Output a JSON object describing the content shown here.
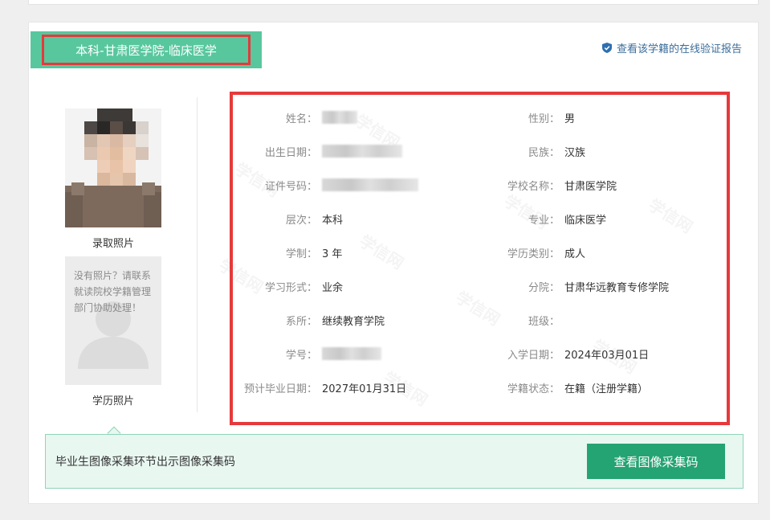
{
  "program_tag": "本科-甘肃医学院-临床医学",
  "verify_link": "查看该学籍的在线验证报告",
  "photos": {
    "admission_caption": "录取照片",
    "degree_caption": "学历照片",
    "placeholder_lines": [
      "没有照片？请联系",
      "就读院校学籍管理",
      "部门协助处理！"
    ]
  },
  "fields": {
    "name_label": "姓名：",
    "gender_label": "性别：",
    "gender_value": "男",
    "birth_label": "出生日期：",
    "ethnicity_label": "民族：",
    "ethnicity_value": "汉族",
    "id_label": "证件号码：",
    "school_label": "学校名称：",
    "school_value": "甘肃医学院",
    "level_label": "层次：",
    "level_value": "本科",
    "major_label": "专业：",
    "major_value": "临床医学",
    "duration_label": "学制：",
    "duration_value": "3 年",
    "category_label": "学历类别：",
    "category_value": "成人",
    "mode_label": "学习形式：",
    "mode_value": "业余",
    "branch_label": "分院：",
    "branch_value": "甘肃华远教育专修学院",
    "department_label": "系所：",
    "department_value": "继续教育学院",
    "class_label": "班级：",
    "class_value": "",
    "student_id_label": "学号：",
    "enroll_label": "入学日期：",
    "enroll_value": "2024年03月01日",
    "grad_label": "预计毕业日期：",
    "grad_value": "2027年01月31日",
    "status_label": "学籍状态：",
    "status_value": "在籍（注册学籍）"
  },
  "notice": {
    "text": "毕业生图像采集环节出示图像采集码",
    "button": "查看图像采集码"
  },
  "watermark": "学信网",
  "colors": {
    "accent_green": "#58c79e",
    "button_green": "#24a373",
    "highlight_red": "#e6393b",
    "link_blue": "#3c6e9b"
  }
}
